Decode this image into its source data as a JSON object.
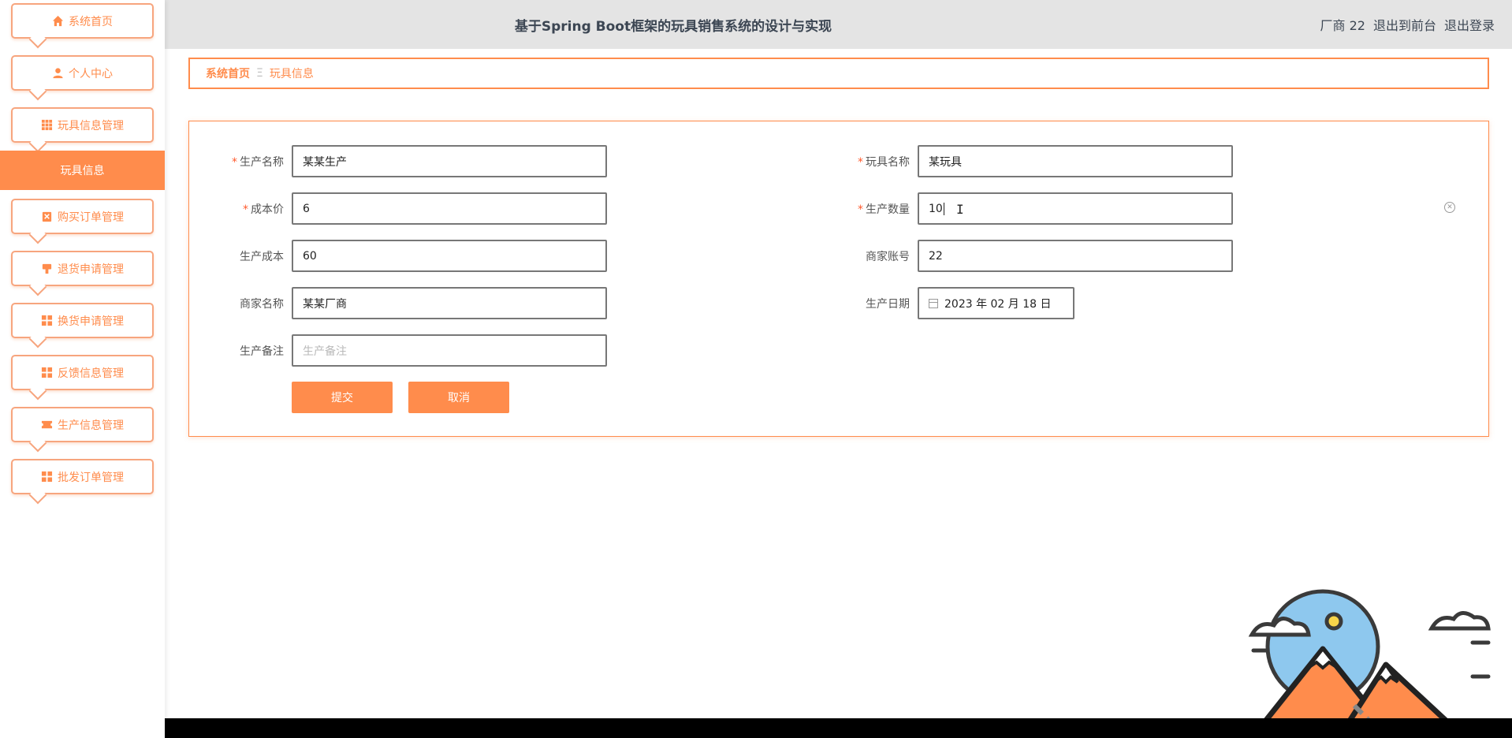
{
  "sidebar": {
    "items": [
      {
        "label": "系统首页",
        "icon": "home-icon"
      },
      {
        "label": "个人中心",
        "icon": "user-icon"
      },
      {
        "label": "玩具信息管理",
        "icon": "grid-icon"
      },
      {
        "label": "购买订单管理",
        "icon": "clipboard-icon"
      },
      {
        "label": "退货申请管理",
        "icon": "stamp-icon"
      },
      {
        "label": "换货申请管理",
        "icon": "apps-icon"
      },
      {
        "label": "反馈信息管理",
        "icon": "apps-icon"
      },
      {
        "label": "生产信息管理",
        "icon": "ticket-icon"
      },
      {
        "label": "批发订单管理",
        "icon": "apps-icon"
      }
    ],
    "active_sub": "玩具信息"
  },
  "header": {
    "title": "基于Spring Boot框架的玩具销售系统的设计与实现",
    "user": "厂商 22",
    "back_front": "退出到前台",
    "logout": "退出登录"
  },
  "breadcrumb": {
    "home": "系统首页",
    "sep": "Ξ",
    "current": "玩具信息"
  },
  "form": {
    "prod_name": {
      "label": "生产名称",
      "value": "某某生产"
    },
    "toy_name": {
      "label": "玩具名称",
      "value": "某玩具"
    },
    "cost_price": {
      "label": "成本价",
      "value": "6"
    },
    "prod_qty": {
      "label": "生产数量",
      "value": "10"
    },
    "prod_cost": {
      "label": "生产成本",
      "value": "60"
    },
    "merchant_acct": {
      "label": "商家账号",
      "value": "22"
    },
    "merchant_name": {
      "label": "商家名称",
      "value": "某某厂商"
    },
    "prod_date": {
      "label": "生产日期",
      "value": "2023 年 02 月 18 日"
    },
    "prod_note": {
      "label": "生产备注",
      "placeholder": "生产备注"
    },
    "submit": "提交",
    "cancel": "取消"
  },
  "colors": {
    "accent": "#ff8c4c",
    "header_bg": "#e4e4e4"
  }
}
